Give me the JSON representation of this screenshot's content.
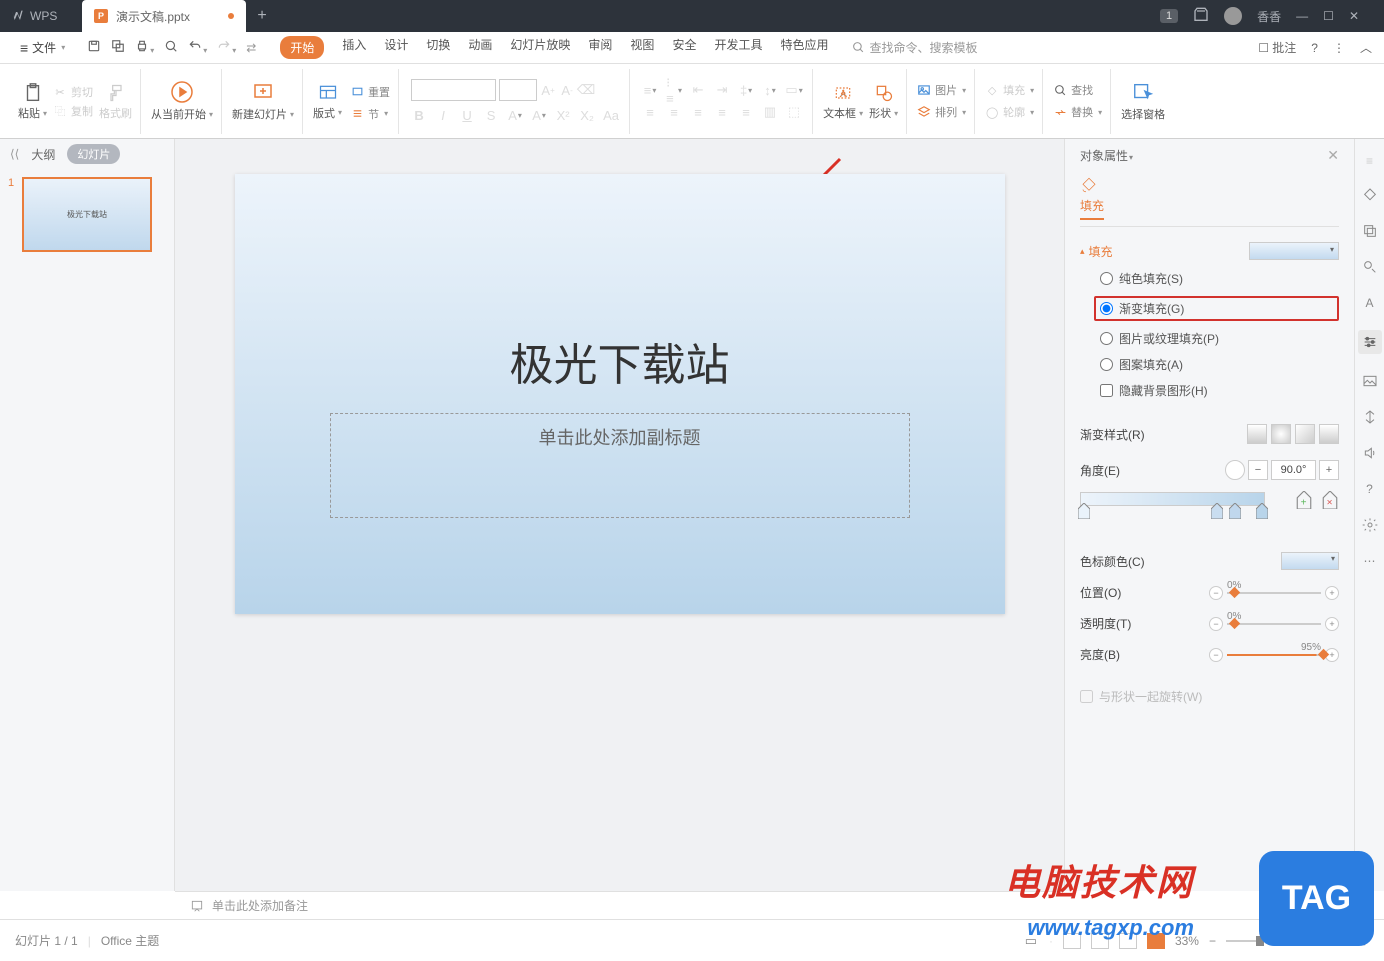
{
  "titlebar": {
    "app": "WPS",
    "doc_name": "演示文稿.pptx",
    "notif_badge": "1",
    "username": "香香"
  },
  "menubar": {
    "file": "文件",
    "tabs": [
      "开始",
      "插入",
      "设计",
      "切换",
      "动画",
      "幻灯片放映",
      "审阅",
      "视图",
      "安全",
      "开发工具",
      "特色应用"
    ],
    "search_placeholder": "查找命令、搜索模板",
    "comment": "批注"
  },
  "toolbar": {
    "paste": "粘贴",
    "cut": "剪切",
    "copy": "复制",
    "format_painter": "格式刷",
    "from_current": "从当前开始",
    "new_slide": "新建幻灯片",
    "layout": "版式",
    "section": "节",
    "reset": "重置",
    "textbox": "文本框",
    "shape": "形状",
    "picture": "图片",
    "arrange": "排列",
    "fill": "填充",
    "outline": "轮廓",
    "find": "查找",
    "replace": "替换",
    "select_pane": "选择窗格"
  },
  "sidebar_left": {
    "outline": "大纲",
    "slides": "幻灯片",
    "slide_num": "1",
    "thumb_text": "极光下载站"
  },
  "slide": {
    "title": "极光下载站",
    "subtitle_placeholder": "单击此处添加副标题"
  },
  "panel": {
    "header": "对象属性",
    "tab_fill": "填充",
    "section_fill": "填充",
    "opts": {
      "solid": "纯色填充(S)",
      "gradient": "渐变填充(G)",
      "picture": "图片或纹理填充(P)",
      "pattern": "图案填充(A)",
      "hide_bg": "隐藏背景图形(H)"
    },
    "grad_style": "渐变样式(R)",
    "angle": "角度(E)",
    "angle_val": "90.0°",
    "stop_color": "色标颜色(C)",
    "position": "位置(O)",
    "position_val": "0%",
    "transparency": "透明度(T)",
    "transparency_val": "0%",
    "brightness": "亮度(B)",
    "brightness_val": "95%",
    "rotate_with_shape": "与形状一起旋转(W)"
  },
  "notes": {
    "placeholder": "单击此处添加备注"
  },
  "status": {
    "slide_info": "幻灯片 1 / 1",
    "theme": "Office 主题",
    "zoom": "33%"
  },
  "watermark": {
    "site_name": "电脑技术网",
    "url": "www.tagxp.com",
    "tag": "TAG"
  }
}
